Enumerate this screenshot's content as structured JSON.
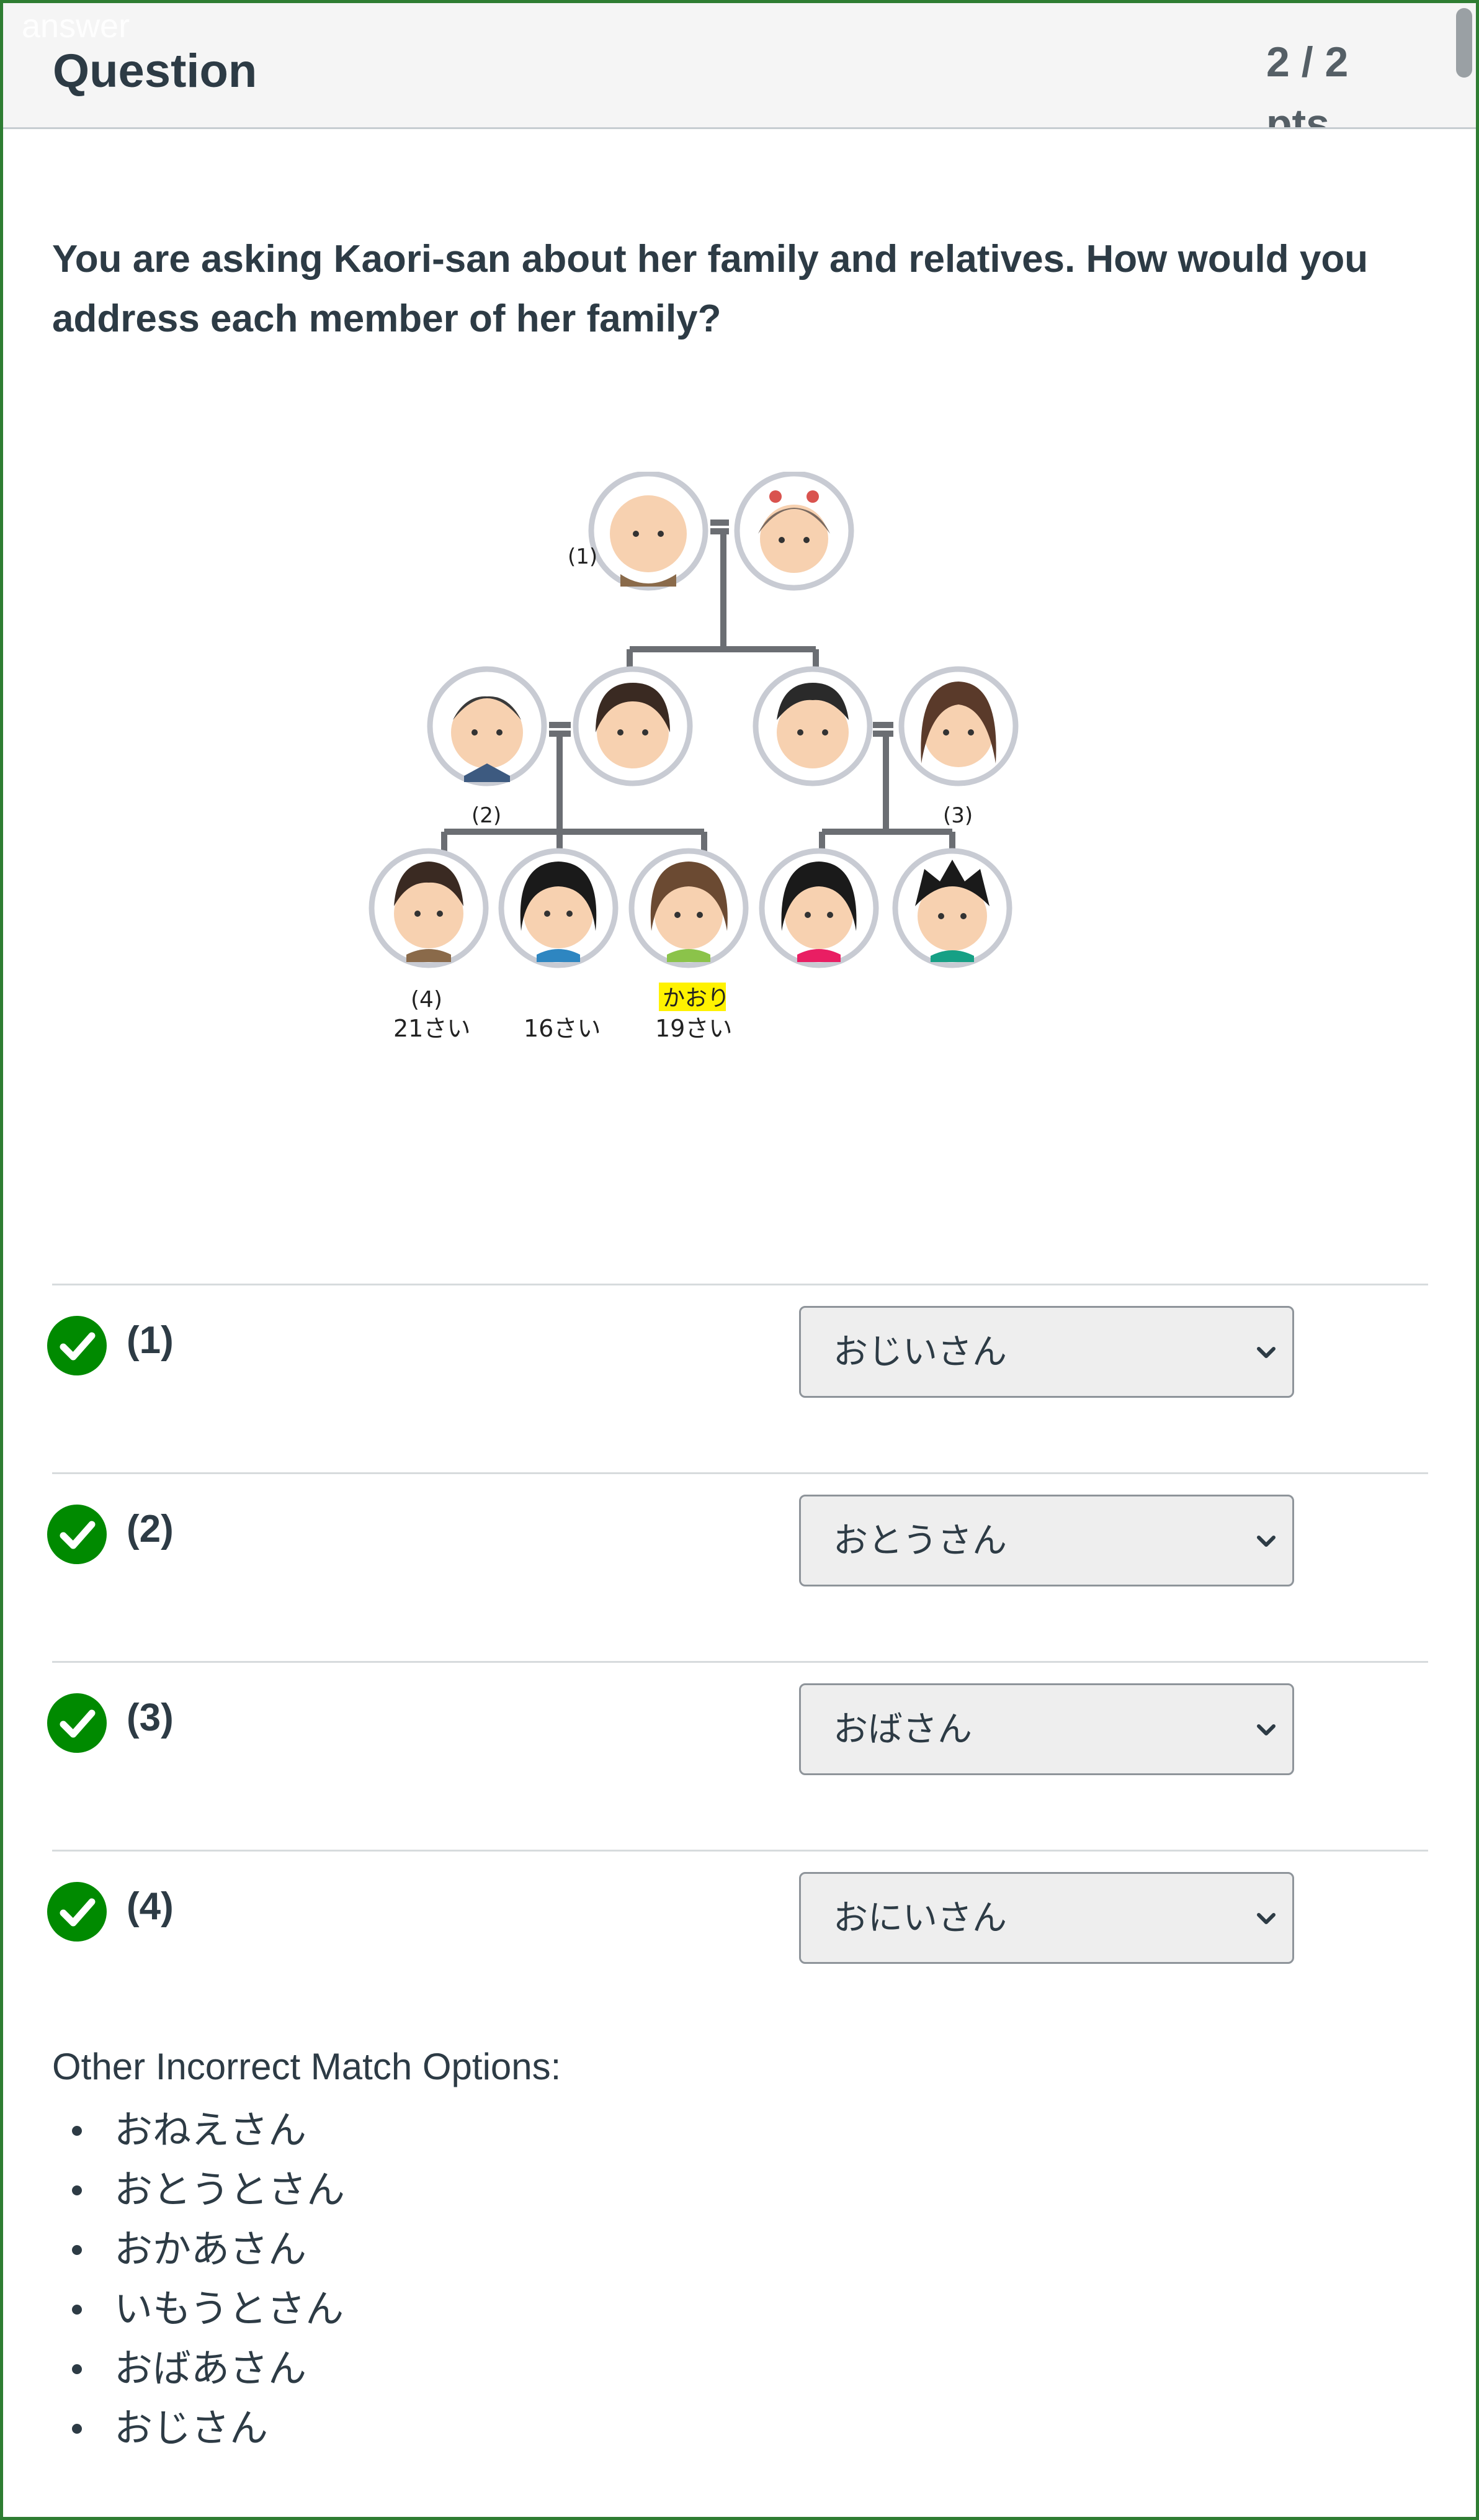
{
  "header": {
    "answer_tag": "answer",
    "title": "Question",
    "points": "2 / 2 pts"
  },
  "question": {
    "text": "You are asking Kaori-san about her family and relatives. How would you address each member of her family?"
  },
  "figure": {
    "labels": [
      "(1)",
      "(2)",
      "(3)",
      "(4)"
    ],
    "highlight_name": "かおり",
    "ages": [
      "21さい",
      "16さい",
      "19さい"
    ]
  },
  "matches": [
    {
      "label": "(1)",
      "selected": "おじいさん",
      "status": "correct"
    },
    {
      "label": "(2)",
      "selected": "おとうさん",
      "status": "correct"
    },
    {
      "label": "(3)",
      "selected": "おばさん",
      "status": "correct"
    },
    {
      "label": "(4)",
      "selected": "おにいさん",
      "status": "correct"
    }
  ],
  "other_options": {
    "title": "Other Incorrect Match Options:",
    "items": [
      "おねえさん",
      "おとうとさん",
      "おかあさん",
      "いもうとさん",
      "おばあさん",
      "おじさん"
    ]
  },
  "colors": {
    "correct": "#008a00",
    "frame": "#2e7d32",
    "text": "#2d3b45",
    "highlight": "#fff200"
  }
}
